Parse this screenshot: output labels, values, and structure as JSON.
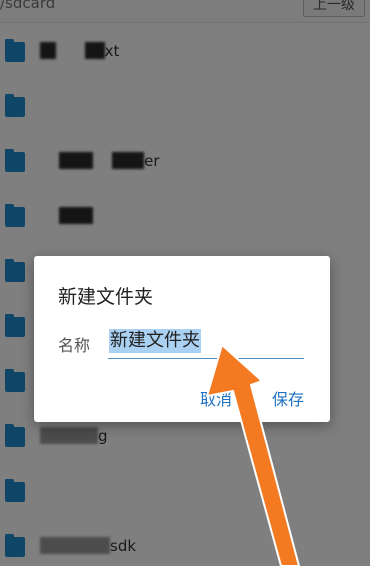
{
  "header": {
    "path": "/sdcard",
    "up_button_label": "上一级"
  },
  "files": [
    {
      "name_suffix": "xt"
    },
    {
      "name_suffix": ""
    },
    {
      "name_suffix": "er"
    },
    {
      "name_suffix": ""
    },
    {
      "name_suffix": ""
    },
    {
      "name_suffix": ""
    },
    {
      "name_suffix": ""
    },
    {
      "name_suffix": "g"
    },
    {
      "name_suffix": ""
    },
    {
      "name_suffix": "sdk"
    }
  ],
  "dialog": {
    "title": "新建文件夹",
    "name_label": "名称",
    "name_value": "新建文件夹",
    "cancel_label": "取消",
    "save_label": "保存"
  },
  "colors": {
    "accent": "#1f73c1",
    "folder": "#1e8ccf",
    "selection": "#aad0f2",
    "arrow": "#f47a22"
  }
}
